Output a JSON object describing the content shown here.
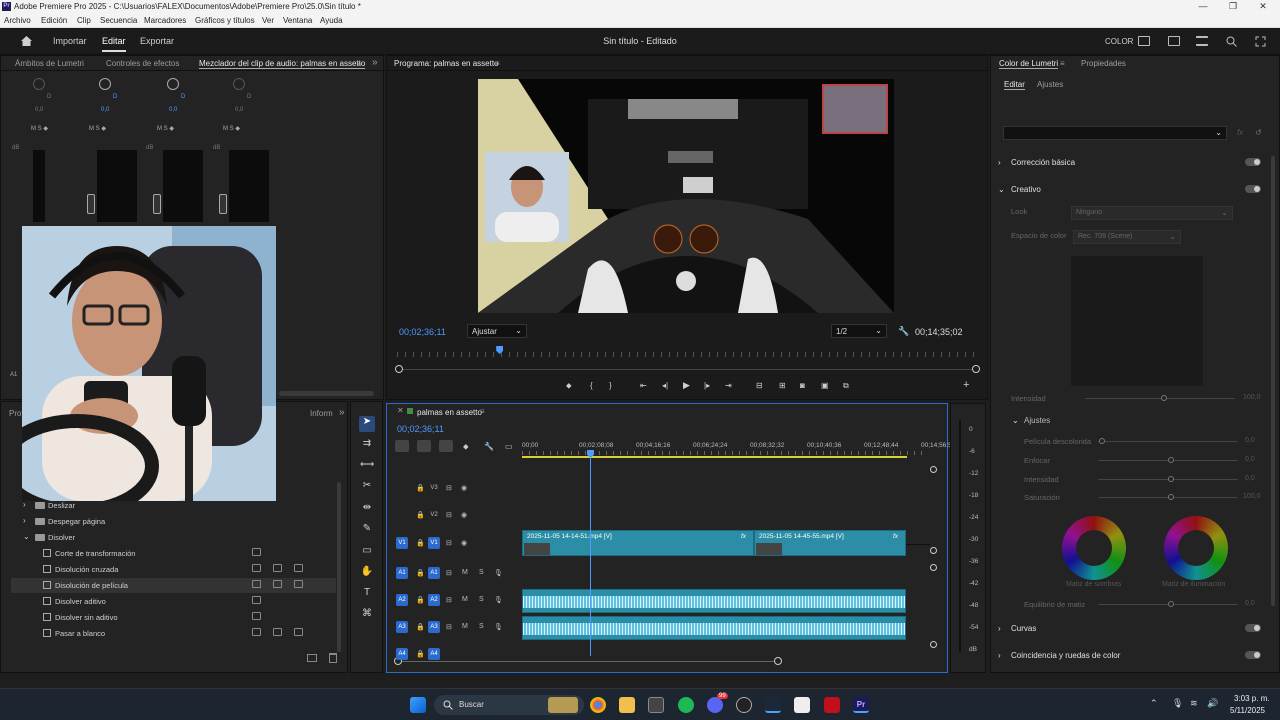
{
  "titlebar": {
    "title": "Adobe Premiere Pro 2025 - C:\\Usuarios\\FALEX\\Documentos\\Adobe\\Premiere Pro\\25.0\\Sin título *",
    "logo": "Pr",
    "minimize": "—",
    "maximize": "❐",
    "close": "✕"
  },
  "menu": [
    "Archivo",
    "Edición",
    "Clip",
    "Secuencia",
    "Marcadores",
    "Gráficos y títulos",
    "Ver",
    "Ventana",
    "Ayuda"
  ],
  "header": {
    "nav": [
      "Importar",
      "Editar",
      "Exportar"
    ],
    "active": "Editar",
    "project_title": "Sin título - Editado",
    "color_label": "COLOR"
  },
  "left_panel": {
    "tabs": [
      "Ámbitos de Lumetri",
      "Controles de efectos",
      "Mezclador del clip de audio: palmas en assetto"
    ],
    "channels": [
      {
        "label": "D",
        "value": "0,0"
      },
      {
        "label": "D",
        "value": "0,0"
      },
      {
        "label": "D",
        "value": "0,0"
      },
      {
        "label": "D",
        "value": "0,0"
      }
    ],
    "msr": "M  S  ◆",
    "db_scale": [
      "dB",
      "6",
      "3",
      "0",
      "-3",
      "-6"
    ],
    "track_label": "A1"
  },
  "effects_panel": {
    "tabs": [
      "Proy",
      "Inform"
    ],
    "items": [
      {
        "name": "Deslizar",
        "type": "folder",
        "indent": 1
      },
      {
        "name": "Despegar página",
        "type": "folder",
        "indent": 1
      },
      {
        "name": "Disolver",
        "type": "folder-open",
        "indent": 1
      },
      {
        "name": "Corte de transformación",
        "type": "fx",
        "badges": 1
      },
      {
        "name": "Disolución cruzada",
        "type": "fx",
        "badges": 3
      },
      {
        "name": "Disolución de película",
        "type": "fx",
        "badges": 3,
        "selected": true
      },
      {
        "name": "Disolver aditivo",
        "type": "fx",
        "badges": 1
      },
      {
        "name": "Disolver sin aditivo",
        "type": "fx",
        "badges": 1
      },
      {
        "name": "Pasar a blanco",
        "type": "fx",
        "badges": 3
      }
    ]
  },
  "program_monitor": {
    "title": "Programa: palmas en assetto",
    "timecode": "00;02;36;11",
    "fit": "Ajustar",
    "resolution": "1/2",
    "duration": "00;14;35;02",
    "playhead_fraction": 0.175
  },
  "timeline": {
    "title": "palmas en assetto",
    "timecode": "00;02;36;11",
    "ruler": [
      "00;00",
      "00;02;08;08",
      "00;04;16;16",
      "00;06;24;24",
      "00;08;32;32",
      "00;10;40;36",
      "00;12;48;44",
      "00;14;56;5"
    ],
    "tracks_video": [
      {
        "name": "V3"
      },
      {
        "name": "V2"
      },
      {
        "name": "V1",
        "patch": "V1"
      }
    ],
    "tracks_audio": [
      {
        "name": "A1",
        "patch": "A1"
      },
      {
        "name": "A2",
        "patch": "A2"
      },
      {
        "name": "A3",
        "patch": "A3"
      },
      {
        "name": "A4",
        "patch": "A4"
      }
    ],
    "clips": [
      {
        "label": "2025-11-05 14-14-51.mp4 [V]"
      },
      {
        "label": "2025-11-05 14-45-55.mp4 [V]"
      }
    ],
    "audio_meter": [
      "0",
      "-6",
      "-12",
      "-18",
      "-24",
      "-30",
      "-36",
      "-42",
      "-48",
      "-54",
      "dB"
    ],
    "ms": {
      "m": "M",
      "s": "S"
    }
  },
  "lumetri": {
    "tabs": [
      "Color de Lumetri",
      "Propiedades"
    ],
    "subtabs": [
      "Editar",
      "Ajustes"
    ],
    "sections": {
      "correccion": "Corrección básica",
      "creativo": "Creativo",
      "curvas": "Curvas",
      "coincidencia": "Coincidencia y ruedas de color"
    },
    "look_label": "Look",
    "look_value": "Ninguno",
    "colorspace_label": "Espacio de color",
    "colorspace_value": "Rec. 709 (Scene)",
    "intensidad": {
      "label": "Intensidad",
      "value": "100,0"
    },
    "ajustes": "Ajustes",
    "sliders": [
      {
        "label": "Película descolorida",
        "value": "0,0"
      },
      {
        "label": "Enfocar",
        "value": "0,0"
      },
      {
        "label": "Intensidad",
        "value": "0,0"
      },
      {
        "label": "Saturación",
        "value": "100,0"
      }
    ],
    "wheels": [
      {
        "label": "Matiz de sombras"
      },
      {
        "label": "Matiz de iluminación"
      }
    ],
    "equilibrio": {
      "label": "Equilibrio de matiz",
      "value": "0,0"
    }
  },
  "taskbar": {
    "search": "Buscar",
    "time": "3:03 p. m.",
    "date": "5/11/2025",
    "badge": "99"
  }
}
